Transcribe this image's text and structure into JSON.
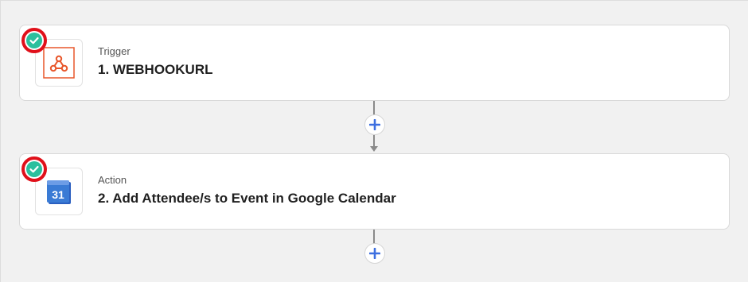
{
  "steps": [
    {
      "kind_label": "Trigger",
      "title": "1. WEBHOOKURL",
      "app_icon": "webhook-icon",
      "status": "complete"
    },
    {
      "kind_label": "Action",
      "title": "2. Add Attendee/s to Event in Google Calendar",
      "app_icon": "google-calendar-icon",
      "calendar_day": "31",
      "status": "complete"
    }
  ],
  "add_step_icon": "plus-icon",
  "colors": {
    "success": "#2bbf9d",
    "highlight_ring": "#e0101a",
    "webhook": "#e8562a",
    "calendar": "#3a7bd5",
    "add_icon": "#3d6fe0"
  }
}
